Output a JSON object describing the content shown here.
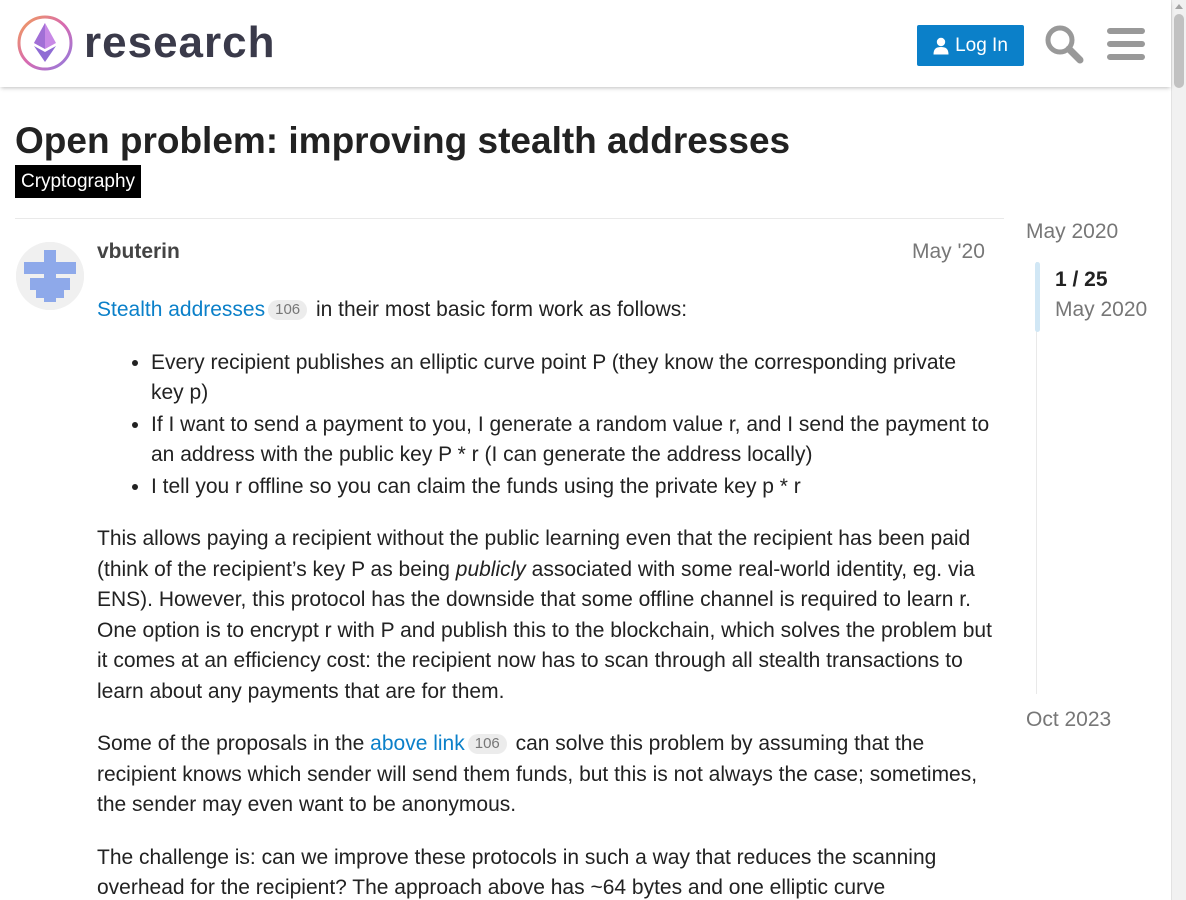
{
  "header": {
    "site_name": "research",
    "login_label": "Log In",
    "search_icon": "search-icon",
    "menu_icon": "hamburger-menu-icon"
  },
  "topic": {
    "title": "Open problem: improving stealth addresses",
    "category": "Cryptography"
  },
  "post": {
    "author": "vbuterin",
    "date": "May '20",
    "p1_link": "Stealth addresses",
    "p1_badge": "106",
    "p1_rest": " in their most basic form work as follows:",
    "bullets": [
      "Every recipient publishes an elliptic curve point P (they know the corresponding private key p)",
      "If I want to send a payment to you, I generate a random value r, and I send the payment to an address with the public key P * r (I can generate the address locally)",
      "I tell you r offline so you can claim the funds using the private key p * r"
    ],
    "p2_a": "This allows paying a recipient without the public learning even that the recipient has been paid (think of the recipient’s key P as being ",
    "p2_em": "publicly",
    "p2_b": " associated with some real-world identity, eg. via ENS). However, this protocol has the downside that some offline channel is required to learn r. One option is to encrypt r with P and publish this to the blockchain, which solves the problem but it comes at an efficiency cost: the recipient now has to scan through all stealth transactions to learn about any payments that are for them.",
    "p3_a": "Some of the proposals in the ",
    "p3_link": "above link",
    "p3_badge": "106",
    "p3_b": " can solve this problem by assuming that the recipient knows which sender will send them funds, but this is not always the case; sometimes, the sender may even want to be anonymous.",
    "p4": "The challenge is: can we improve these protocols in such a way that reduces the scanning overhead for the recipient? The approach above has ~64 bytes and one elliptic curve"
  },
  "timeline": {
    "start": "May 2020",
    "position": "1 / 25",
    "position_date": "May 2020",
    "end": "Oct 2023"
  },
  "colors": {
    "accent": "#0b80c9",
    "category_bg": "#000000",
    "timeline_handle": "#d1e7f5"
  }
}
